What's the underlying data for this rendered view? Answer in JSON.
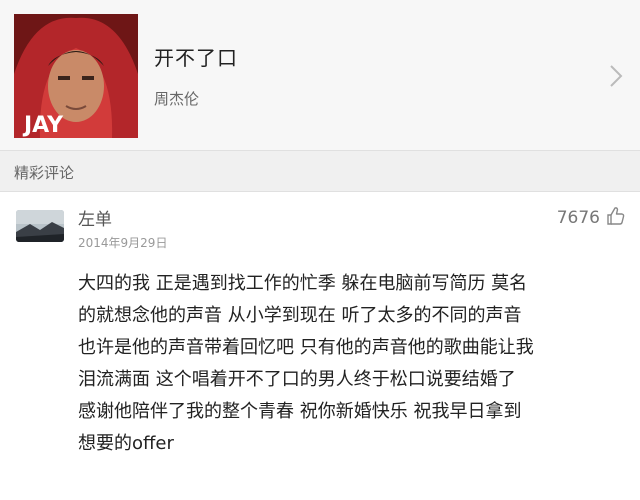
{
  "song": {
    "title": "开不了口",
    "artist": "周杰伦",
    "cover_text": "JAY"
  },
  "comments_section": {
    "title": "精彩评论"
  },
  "comment": {
    "user": "左单",
    "date": "2014年9月29日",
    "likes": "7676",
    "lines": [
      "大四的我 正是遇到找工作的忙季 躲在电脑前写简历 莫名",
      "的就想念他的声音 从小学到现在 听了太多的不同的声音",
      "也许是他的声音带着回忆吧 只有他的声音他的歌曲能让我",
      "泪流满面 这个唱着开不了口的男人终于松口说要结婚了",
      "感谢他陪伴了我的整个青春 祝你新婚快乐 祝我早日拿到",
      "想要的offer"
    ]
  },
  "icons": {
    "chevron": "chevron-right-icon",
    "like": "thumb-up-icon"
  },
  "colors": {
    "header_bg": "#f7f7f7",
    "section_bg": "#f0f0f0",
    "text_primary": "#222222",
    "text_secondary": "#999999"
  }
}
